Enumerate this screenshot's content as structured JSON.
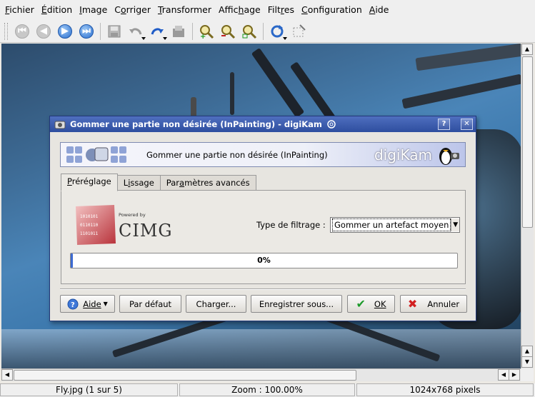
{
  "menu": [
    {
      "mn": "F",
      "rest": "ichier"
    },
    {
      "mn": "É",
      "rest": "dition"
    },
    {
      "mn": "I",
      "rest": "mage"
    },
    {
      "pre": "C",
      "mn": "o",
      "rest": "rriger"
    },
    {
      "mn": "T",
      "rest": "ransformer"
    },
    {
      "pre": "Affic",
      "mn": "h",
      "rest": "age"
    },
    {
      "pre": "Filt",
      "mn": "r",
      "rest": "es"
    },
    {
      "mn": "C",
      "rest": "onfiguration"
    },
    {
      "mn": "A",
      "rest": "ide"
    }
  ],
  "toolbar_icons": [
    "back",
    "prev",
    "next",
    "last",
    "save",
    "undo",
    "redo",
    "export",
    "zoom-in",
    "zoom-out",
    "zoom-fit",
    "rotate",
    "crop"
  ],
  "dialog": {
    "title": "Gommer une partie non désirée (InPainting) - digiKam",
    "banner_text": "Gommer une partie non désirée (InPainting)",
    "banner_logo": "digiKam",
    "tabs": [
      {
        "mn": "P",
        "rest": "réréglage"
      },
      {
        "pre": "L",
        "mn": "i",
        "rest": "ssage"
      },
      {
        "pre": "Par",
        "mn": "a",
        "rest": "mètres avancés"
      }
    ],
    "powered_by": "Powered by",
    "cimg_logo": "CImg",
    "filter_label": "Type de filtrage :",
    "filter_value": "Gommer un artefact moyen",
    "progress_label": "0%",
    "buttons": {
      "aide": "Aide",
      "defaut": "Par défaut",
      "charger": "Charger...",
      "enregistrer": "Enregistrer sous...",
      "ok": "OK",
      "annuler": "Annuler"
    }
  },
  "status": {
    "file": "Fly.jpg (1 sur 5)",
    "zoom": "Zoom : 100.00%",
    "size": "1024x768 pixels"
  },
  "progress_value": 0
}
